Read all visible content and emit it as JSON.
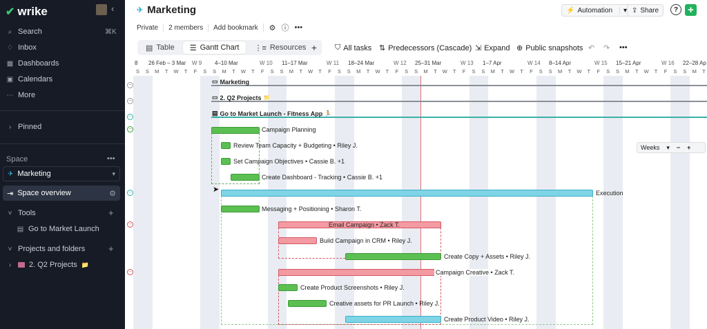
{
  "app": {
    "logo": "wrike"
  },
  "sidebar": {
    "search": "Search",
    "search_shortcut": "⌘K",
    "inbox": "Inbox",
    "dashboards": "Dashboards",
    "calendars": "Calendars",
    "more": "More",
    "pinned": "Pinned",
    "space_label": "Space",
    "space_name": "Marketing",
    "space_overview": "Space overview",
    "tools_label": "Tools",
    "tools_item": "Go to Market Launch",
    "projects_label": "Projects and folders",
    "project_item": "2. Q2 Projects"
  },
  "header": {
    "title": "Marketing",
    "privacy": "Private",
    "members": "2 members",
    "bookmark": "Add bookmark",
    "automation": "Automation",
    "share": "Share",
    "help": "?",
    "add": "+"
  },
  "views": {
    "table": "Table",
    "gantt": "Gantt Chart",
    "resources": "Resources"
  },
  "toolbar": {
    "all_tasks": "All tasks",
    "predecessors": "Predecessors (Cascade)",
    "expand": "Expand",
    "snapshots": "Public snapshots"
  },
  "timeline": {
    "weeks": [
      {
        "label": "8"
      },
      {
        "label": "26 Feb – 3 Mar"
      },
      {
        "label": "W 9"
      },
      {
        "label": "4–10 Mar"
      },
      {
        "label": "W 10"
      },
      {
        "label": "11–17 Mar"
      },
      {
        "label": "W 11"
      },
      {
        "label": "18–24 Mar"
      },
      {
        "label": "W 12"
      },
      {
        "label": "25–31 Mar"
      },
      {
        "label": "W 13"
      },
      {
        "label": "1–7 Apr"
      },
      {
        "label": "W 14"
      },
      {
        "label": "8–14 Apr"
      },
      {
        "label": "W 15"
      },
      {
        "label": "15–21 Apr"
      },
      {
        "label": "W 16"
      },
      {
        "label": "22–28 Ap"
      }
    ],
    "days": [
      "S",
      "S",
      "M",
      "T",
      "W",
      "T",
      "F",
      "S",
      "S",
      "M",
      "T",
      "W",
      "T",
      "F",
      "S",
      "S",
      "M",
      "T",
      "W",
      "T",
      "F",
      "S",
      "S",
      "M",
      "T",
      "W",
      "T",
      "F",
      "S",
      "S",
      "M",
      "T",
      "W",
      "T",
      "F",
      "S",
      "S",
      "M",
      "T",
      "W",
      "T",
      "F",
      "S",
      "S",
      "M",
      "T",
      "W",
      "T",
      "F",
      "S",
      "S",
      "M",
      "T",
      "W",
      "T",
      "F",
      "S",
      "S",
      "M",
      "T",
      "W",
      "T",
      "F",
      "S",
      "S",
      "M",
      "T",
      "W",
      "T",
      "F",
      "S",
      "S",
      "M",
      "T",
      "W",
      "T"
    ],
    "scale": "Weeks",
    "zoom_out": "−",
    "zoom_in": "+"
  },
  "tasks": {
    "marketing": "Marketing",
    "q2": "2. Q2 Projects",
    "gtm": "Go to Market Launch - Fitness App",
    "campaign_planning": "Campaign Planning",
    "review": "Review Team Capacity + Budgeting • Riley J.",
    "objectives": "Set Campaign Objectives • Cassie B. +1",
    "dashboard": "Create Dashboard - Tracking • Cassie B. +1",
    "execution": "Execution",
    "messaging": "Messaging + Positioning • Sharon T.",
    "email": "Email Campaign • Zack T.",
    "crm": "Build Campaign in CRM • Riley J.",
    "copy": "Create Copy + Assets • Riley J.",
    "creative": "Campaign Creative • Zack T.",
    "screenshots": "Create Product Screenshots • Riley J.",
    "pr": "Creative assets for PR Launch • Riley J.",
    "video": "Create Product Video • Riley J."
  }
}
